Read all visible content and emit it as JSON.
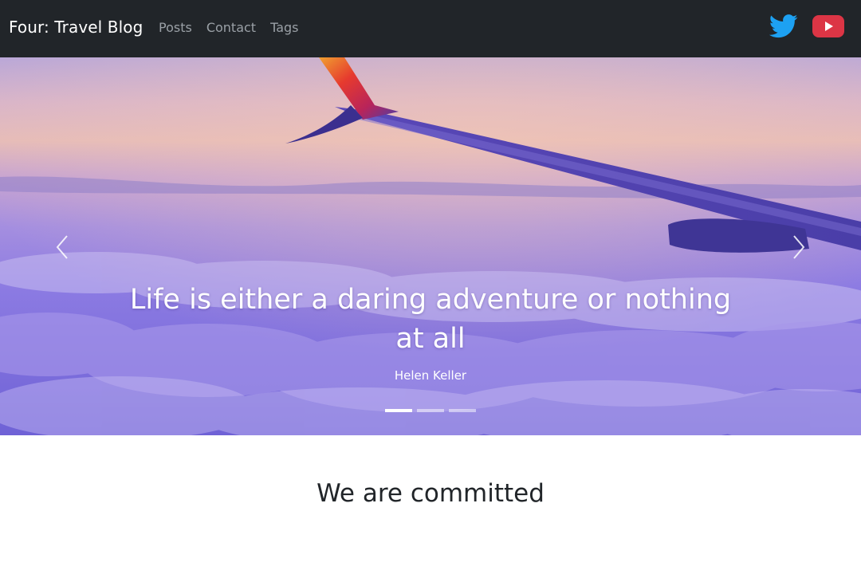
{
  "navbar": {
    "brand": "Four: Travel Blog",
    "links": [
      {
        "label": "Posts"
      },
      {
        "label": "Contact"
      },
      {
        "label": "Tags"
      }
    ],
    "social": [
      {
        "icon": "twitter-icon",
        "color": "#1da1f2"
      },
      {
        "icon": "youtube-icon",
        "color": "#dc3545"
      }
    ]
  },
  "carousel": {
    "slide": {
      "quote": "Life is either a daring adventure or nothing at all",
      "author": "Helen Keller"
    },
    "controls": {
      "prev_icon": "chevron-left-icon",
      "next_icon": "chevron-right-icon"
    },
    "indicators": {
      "count": 3,
      "active": 1
    }
  },
  "section": {
    "title": "We are committed"
  },
  "colors": {
    "navbar_bg": "#212529",
    "brand_text": "#ffffff",
    "nav_link": "#9aa0a6"
  }
}
